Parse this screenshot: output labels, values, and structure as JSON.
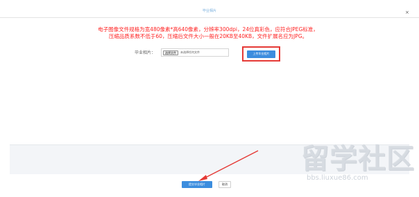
{
  "dialog": {
    "title": "毕业相片",
    "close_label": "×"
  },
  "notice": {
    "line1": "电子图像文件规格为宽480像素*高640像素，分辨率300dpi，24位真彩色，应符合JPEG标准，",
    "line2": "压缩品质系数不低于60，压缩后文件大小一般在20KB至40KB，文件扩展名应为JPG。",
    "color": "#ff2222"
  },
  "form": {
    "photo_label": "毕业相片：",
    "choose_file_label": "选择文件",
    "no_file_text": "未选择任何文件",
    "upload_button_label": "上传毕业相片"
  },
  "footer": {
    "submit_label": "提交毕业相片",
    "cancel_label": "取消"
  },
  "watermark": {
    "text": "留学社区",
    "url": "bbs.liuxue86.com"
  },
  "colors": {
    "primary": "#3c8dde",
    "highlight": "#e53935"
  }
}
